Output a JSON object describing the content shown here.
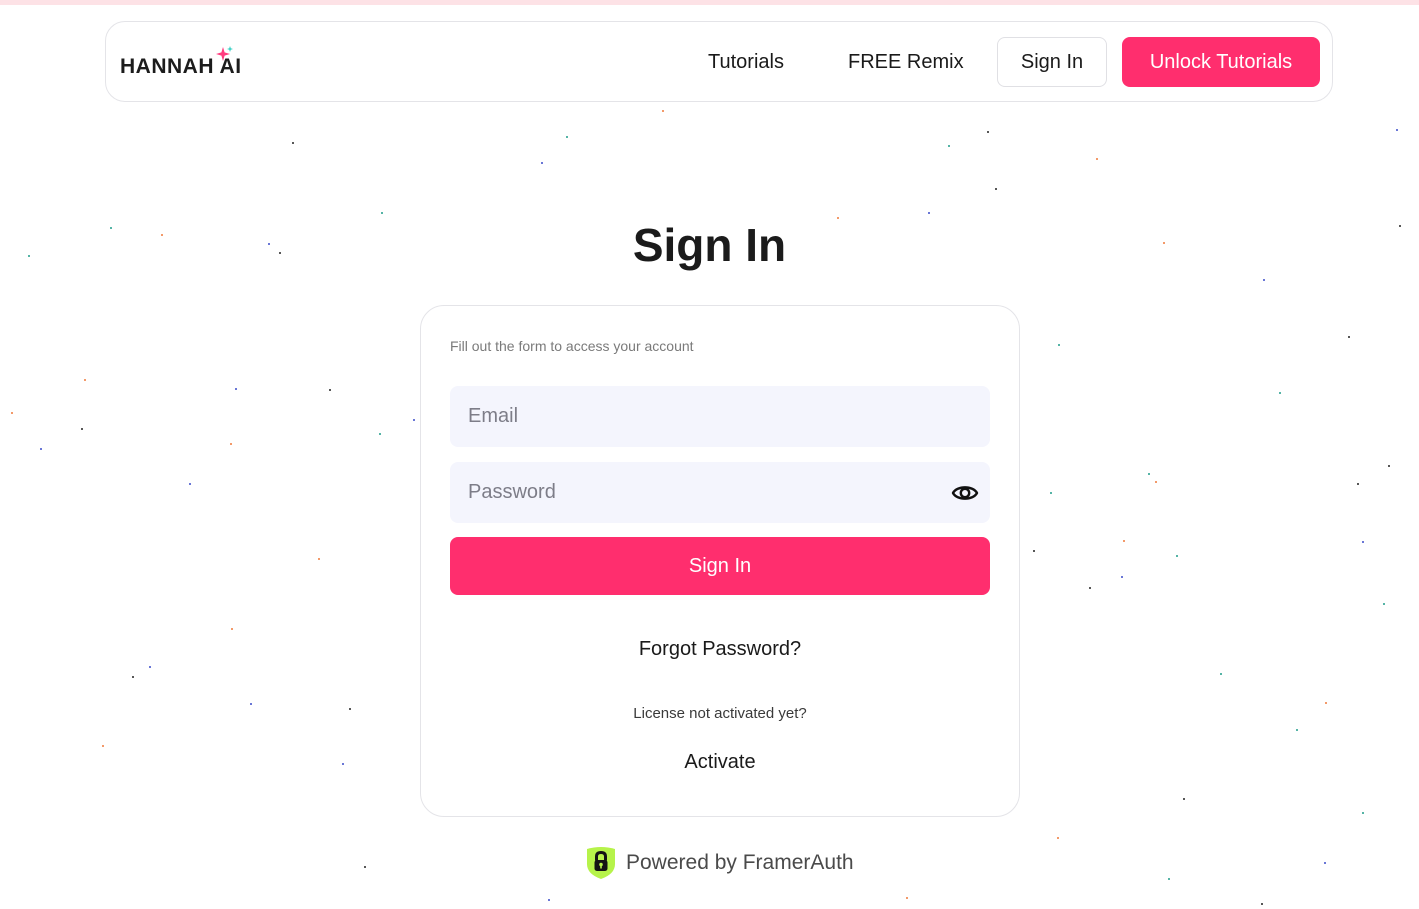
{
  "brand": {
    "logo_text": "HANNAH AI",
    "accent_color": "#ff2e6e",
    "sparkle_colors": [
      "#ff3c7e",
      "#3ad1c5"
    ]
  },
  "nav": {
    "links": [
      {
        "label": "Tutorials"
      },
      {
        "label": "FREE Remix"
      }
    ],
    "signin_label": "Sign In",
    "cta_label": "Unlock Tutorials"
  },
  "page": {
    "title": "Sign In"
  },
  "form": {
    "subtitle": "Fill out the form to access your account",
    "email_placeholder": "Email",
    "password_placeholder": "Password",
    "password_toggle_icon": "eye-icon",
    "submit_label": "Sign In",
    "forgot_label": "Forgot Password?",
    "license_prompt": "License not activated yet?",
    "activate_label": "Activate"
  },
  "footer": {
    "powered_by": "Powered by FramerAuth",
    "badge_icon": "shield-lock-icon",
    "badge_color": "#b6f34a"
  },
  "background": {
    "dot_colors": [
      "#3a4cc9",
      "#ef7a3a",
      "#1f9c8a",
      "#222222"
    ]
  }
}
